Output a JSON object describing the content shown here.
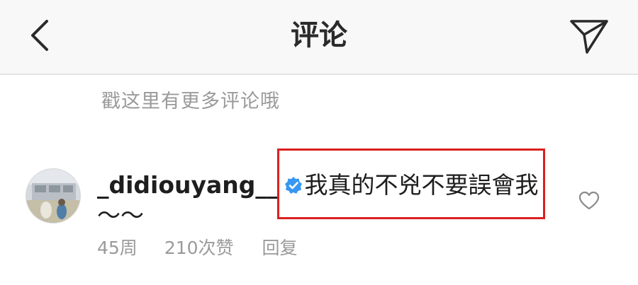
{
  "header": {
    "title": "评论",
    "back_icon": "chevron-left-icon",
    "share_icon": "paper-plane-icon"
  },
  "hint": "戳这里有更多评论哦",
  "comment": {
    "username": "_didiouyang__",
    "verified_icon": "verified-badge-icon",
    "text": "我真的不兇不要誤會我",
    "text_continued": "～～",
    "age": "45周",
    "likes": "210次赞",
    "reply_label": "回复",
    "like_icon": "heart-outline-icon"
  },
  "colors": {
    "highlight_box": "#d9201f",
    "verified_badge": "#3897f0",
    "meta_text": "#9a9a9a",
    "header_bg": "#f8f8f8"
  }
}
